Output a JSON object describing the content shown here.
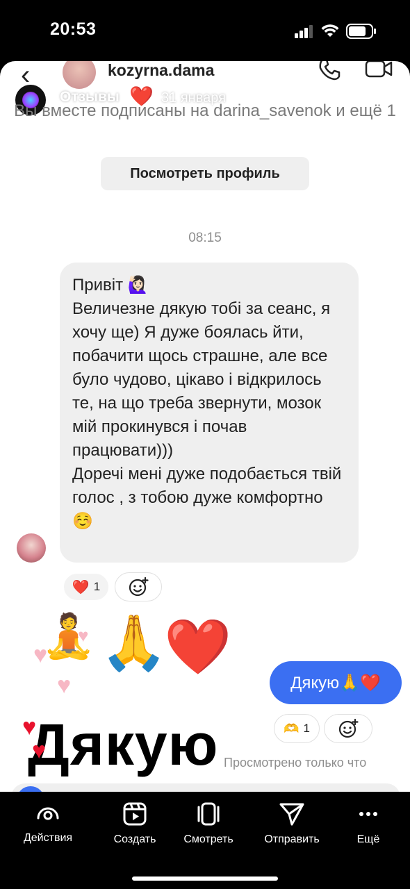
{
  "status_bar": {
    "time": "20:53"
  },
  "chat": {
    "username": "kozyrna.dama",
    "mutual_text": "Вы вместе подписаны на darina_savenok и ещё 1",
    "view_profile_label": "Посмотреть профиль",
    "timestamp": "08:15",
    "incoming_message": {
      "lines": [
        "Привіт 🙋🏻‍♀️",
        "Величезне дякую тобі за сеанс, я хочу ще) Я дуже боялась йти, побачити щось страшне, але все було чудово, цікаво і відкрилось те, на що треба звернути, мозок мій прокинувся і почав працювати)))",
        "Доречі мені дуже подобається твій голос , з тобою дуже комфортно ☺️"
      ],
      "reaction_emoji": "❤️",
      "reaction_count": "1"
    },
    "stickers": [
      "🧘",
      "🙏",
      "❤️"
    ],
    "outgoing_message": "Дякую🙏❤️",
    "outgoing_reaction_emoji": "🫶",
    "outgoing_reaction_count": "1",
    "seen_label": "Просмотрено только что"
  },
  "story": {
    "title": "Отзывы",
    "title_emoji": "❤️",
    "date": "31 января",
    "caption": "Дякую"
  },
  "bottom_nav": [
    {
      "label": "Действия",
      "icon": "activity-icon"
    },
    {
      "label": "Создать",
      "icon": "create-icon"
    },
    {
      "label": "Смотреть",
      "icon": "view-icon"
    },
    {
      "label": "Отправить",
      "icon": "send-icon"
    },
    {
      "label": "Ещё",
      "icon": "more-icon"
    }
  ],
  "colors": {
    "accent_blue": "#3b6ff2",
    "heart_red": "#e8122d",
    "bubble_gray": "#efefef"
  }
}
